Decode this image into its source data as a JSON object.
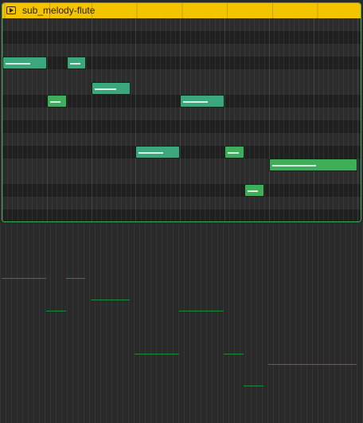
{
  "region": {
    "name": "sub_melody-flute",
    "header_color": "#f5c400",
    "icon": "play-icon"
  },
  "notes": [
    {
      "col": 0,
      "len": 9,
      "row": 3,
      "color": "#3aa87c"
    },
    {
      "col": 13,
      "len": 4,
      "row": 3,
      "color": "#3aa87c"
    },
    {
      "col": 18,
      "len": 8,
      "row": 5,
      "color": "#3aa87c"
    },
    {
      "col": 9,
      "len": 4,
      "row": 6,
      "color": "#3fae5a"
    },
    {
      "col": 36,
      "len": 9,
      "row": 6,
      "color": "#3aa87c"
    },
    {
      "col": 27,
      "len": 9,
      "row": 10,
      "color": "#3aa87c"
    },
    {
      "col": 45,
      "len": 4,
      "row": 10,
      "color": "#3fae5a"
    },
    {
      "col": 54,
      "len": 18,
      "row": 11,
      "color": "#3fae5a"
    },
    {
      "col": 49,
      "len": 4,
      "row": 13,
      "color": "#3fae5a"
    }
  ],
  "velocity": {
    "color": "#1f8a38"
  }
}
